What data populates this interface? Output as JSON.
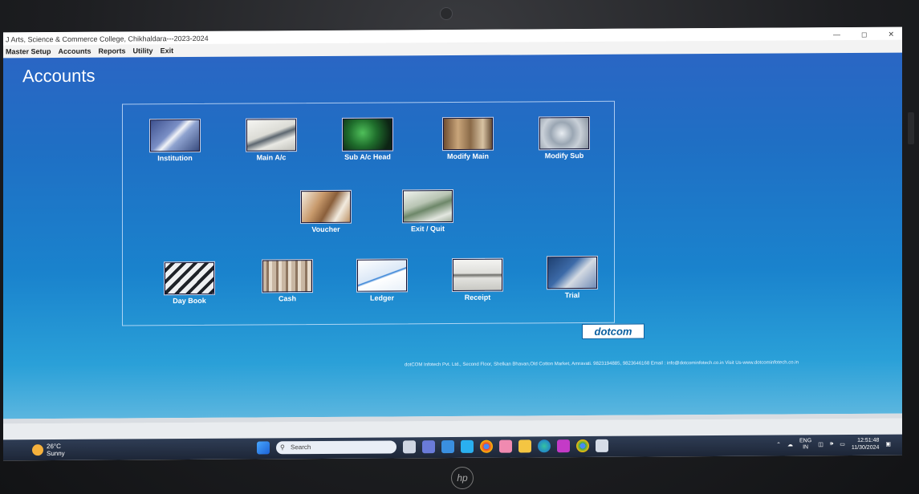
{
  "window": {
    "title": "J Arts, Science & Commerce College, Chikhaldara---2023-2024",
    "controls": [
      "—",
      "◻",
      "✕"
    ]
  },
  "menu": [
    "Master Setup",
    "Accounts",
    "Reports",
    "Utility",
    "Exit"
  ],
  "page": {
    "title": "Accounts"
  },
  "tiles": [
    {
      "label": "Institution"
    },
    {
      "label": "Main A/c"
    },
    {
      "label": "Sub A/c Head"
    },
    {
      "label": "Modify Main"
    },
    {
      "label": "Modify Sub"
    },
    {
      "label": "Voucher"
    },
    {
      "label": "Exit / Quit"
    },
    {
      "label": "Day Book"
    },
    {
      "label": "Cash"
    },
    {
      "label": "Ledger"
    },
    {
      "label": "Receipt"
    },
    {
      "label": "Trial"
    }
  ],
  "logo": "dotcom",
  "footer": "dotCOM Infotech Pvt. Ltd., Second Floor, Shelkan Bhavan,Old Cotton Market, Amravati. 9823194885, 9823646168 Email : info@dotcominfotech.co.in  Visit Us-www.dotcominfotech.co.in",
  "taskbar": {
    "weather_temp": "26°C",
    "weather_desc": "Sunny",
    "search_placeholder": "Search",
    "lang_top": "ENG",
    "lang_bottom": "IN",
    "time": "12:51:48",
    "date": "11/30/2024"
  },
  "colors": {
    "accent": "#1f6fc4",
    "brand": "#0b5fa0"
  }
}
